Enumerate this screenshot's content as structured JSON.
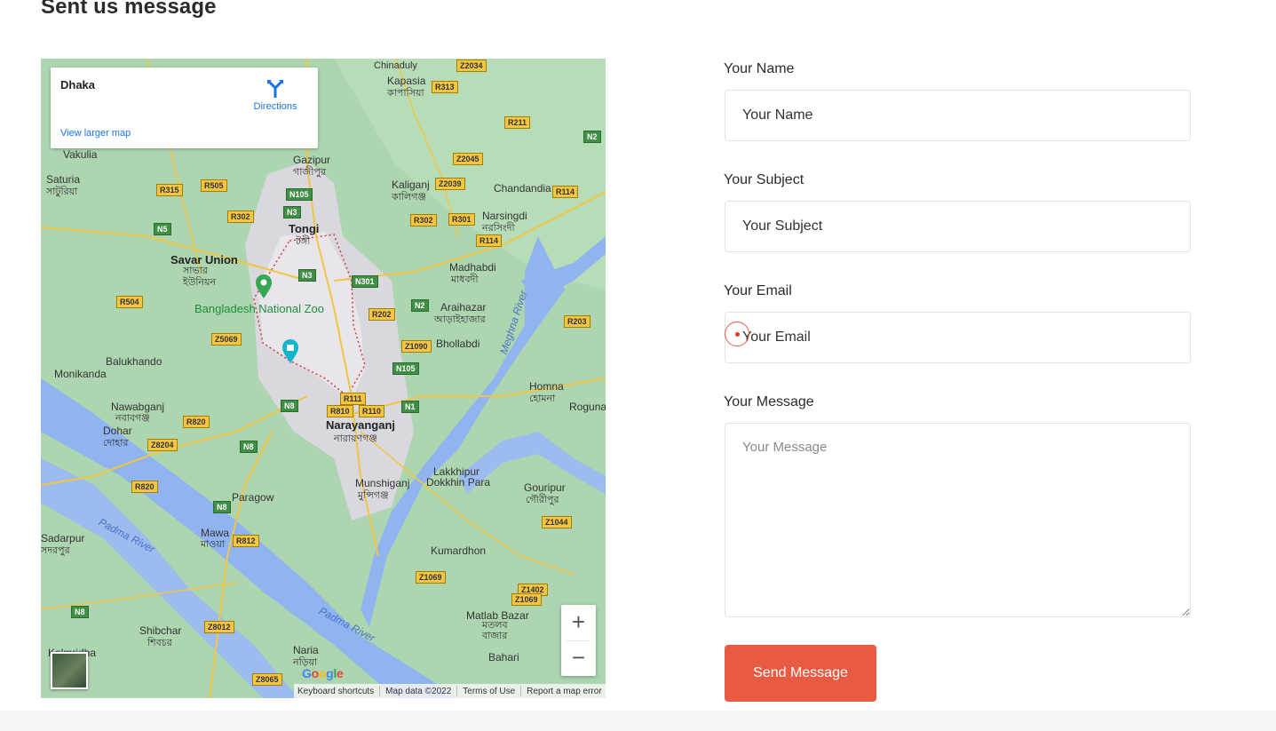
{
  "section": {
    "title": "Sent us message"
  },
  "map": {
    "place_name": "Dhaka",
    "directions_label": "Directions",
    "larger_map_link": "View larger map",
    "zoom_in": "+",
    "zoom_out": "−",
    "attribution": {
      "keyboard": "Keyboard shortcuts",
      "map_data": "Map data ©2022",
      "terms": "Terms of Use",
      "report": "Report a map error"
    },
    "logo": [
      "G",
      "o",
      "o",
      "g",
      "l",
      "e"
    ],
    "places": {
      "tongi": "Tongi",
      "tongi_bn": "টঙ্গী",
      "savar": "Savar Union",
      "savar_bn": "সাভার ইউনিয়ন",
      "zoo": "Bangladesh National Zoo",
      "narayanganj": "Narayanganj",
      "narayanganj_bn": "নারায়ণগঞ্জ",
      "gazipur": "Gazipur",
      "gazipur_bn": "গাজীপুর",
      "kaliganj": "Kaliganj",
      "kaliganj_bn": "কালিগঞ্জ",
      "narsingdi": "Narsingdi",
      "narsingdi_bn": "নরসিংদী",
      "chandandia": "Chandandia",
      "madhabdi": "Madhabdi",
      "madhabdi_bn": "মাধবদী",
      "araihazar": "Araihazar",
      "araihazar_bn": "আড়াইহাজার",
      "bhollabdi": "Bhollabdi",
      "chinaduly": "Chinaduly",
      "kapasia": "Kapasia",
      "kapasia_bn": "কাপাসিয়া",
      "vakulia": "Vakulia",
      "saturia": "Saturia",
      "saturia_bn": "সাটুরিয়া",
      "balukhando": "Balukhando",
      "monikanda": "Monikanda",
      "nawabganj": "Nawabganj",
      "nawabganj_bn": "নবাবগঞ্জ",
      "dohar": "Dohar",
      "dohar_bn": "দোহার",
      "paragow": "Paragow",
      "mawa": "Mawa",
      "mawa_bn": "মাওয়া",
      "munshiganj": "Munshiganj",
      "munshiganj_bn": "মুন্সিগঞ্জ",
      "lakkhipur": "Lakkhipur",
      "dokkhin_para": "Dokkhin Para",
      "homna": "Homna",
      "homna_bn": "হোমনা",
      "roguna": "Roguna",
      "gouripur": "Gouripur",
      "gouripur_bn": "গৌরীপুর",
      "kumardhon": "Kumardhon",
      "matlab": "Matlab Bazar",
      "matlab_bn": "মতলব বাজার",
      "bahari": "Bahari",
      "shibchar": "Shibchar",
      "shibchar_bn": "শিবচর",
      "naria": "Naria",
      "naria_bn": "নড়িয়া",
      "sadarpur": "Sadarpur",
      "sadarpur_bn": "সদরপুর",
      "kalmridha": "Kalmridha",
      "padma_river": "Padma River",
      "meghna_river": "Meghna River"
    },
    "roads": [
      "Z2034",
      "R313",
      "R211",
      "N2",
      "Z2045",
      "Z2039",
      "R114",
      "R302",
      "R301",
      "R114",
      "N105",
      "N3",
      "R315",
      "R505",
      "R302",
      "N5",
      "N3",
      "N301",
      "R504",
      "R202",
      "N2",
      "R203",
      "Z5069",
      "Z1090",
      "N105",
      "R111",
      "R810",
      "R110",
      "N8",
      "N1",
      "R820",
      "Z8204",
      "N8",
      "R820",
      "N8",
      "R812",
      "Z1069",
      "Z1402",
      "Z1069",
      "Z1044",
      "N8",
      "Z8012",
      "Z8065"
    ]
  },
  "form": {
    "name_label": "Your Name",
    "name_placeholder": "Your Name",
    "subject_label": "Your Subject",
    "subject_placeholder": "Your Subject",
    "email_label": "Your Email",
    "email_placeholder": "Your Email",
    "message_label": "Your Message",
    "message_placeholder": "Your Message",
    "submit_label": "Send Message"
  }
}
